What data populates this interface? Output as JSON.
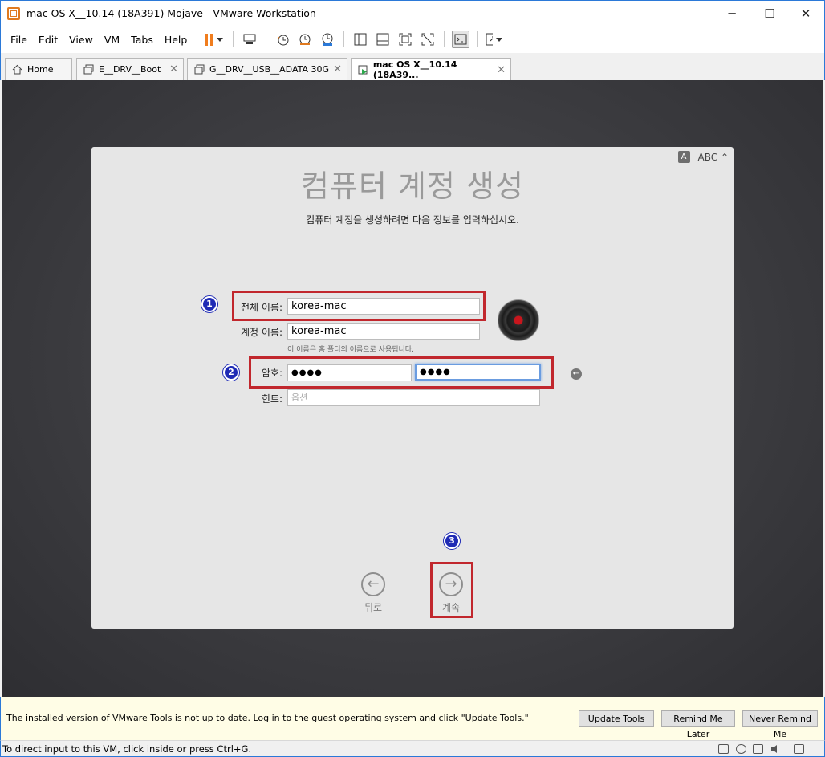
{
  "window": {
    "title": "mac OS X__10.14 (18A391) Mojave - VMware Workstation",
    "minimize": "─",
    "maximize": "☐",
    "close": "✕"
  },
  "menu": [
    "File",
    "Edit",
    "View",
    "VM",
    "Tabs",
    "Help"
  ],
  "tabs": [
    {
      "label": "Home",
      "close": ""
    },
    {
      "label": "E__DRV__Boot",
      "close": "✕"
    },
    {
      "label": "G__DRV__USB__ADATA 30G",
      "close": "✕"
    },
    {
      "label": "mac OS X__10.14 (18A39...",
      "close": "✕"
    }
  ],
  "mac": {
    "input_indicator": {
      "icon_letter": "A",
      "label": "ABC ⌃"
    },
    "title": "컴퓨터 계정 생성",
    "subtitle": "컴퓨터 계정을 생성하려면 다음 정보를 입력하십시오.",
    "full_name_label": "전체 이름:",
    "full_name_value": "korea-mac",
    "account_name_label": "계정 이름:",
    "account_name_value": "korea-mac",
    "account_hint": "이 이름은 홈 폴더의 이름으로 사용됩니다.",
    "password_label": "암호:",
    "password_value": "●●●●",
    "verify_value": "●●●●",
    "hint_label": "힌트:",
    "hint_placeholder": "옵션",
    "back_label": "뒤로",
    "continue_label": "계속",
    "back_glyph": "←",
    "continue_glyph": "→",
    "return_glyph": "←"
  },
  "badges": [
    "1",
    "2",
    "3"
  ],
  "notification": {
    "message": "The installed version of VMware Tools is not up to date. Log in to the guest operating system and click \"Update Tools.\"",
    "update": "Update Tools",
    "remind": "Remind Me Later",
    "never": "Never Remind Me"
  },
  "status": {
    "text": "To direct input to this VM, click inside or press Ctrl+G."
  },
  "colors": {
    "annotation_red": "#c1272d",
    "badge_blue": "#1f2bb5",
    "pause_orange": "#f07d1e"
  }
}
